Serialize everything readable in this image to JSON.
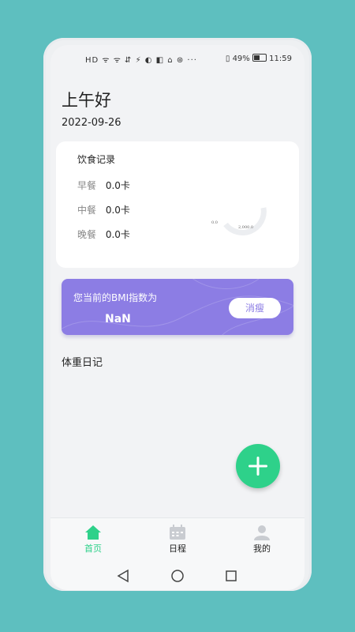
{
  "status_bar": {
    "left_icons": "HD ᯤ ᯤ ⇵ ⚡ ◐ ◧ ⌂ ⊛ ···",
    "battery": "49%",
    "time": "11:59"
  },
  "greeting": "上午好",
  "date": "2022-09-26",
  "diet_card": {
    "title": "饮食记录",
    "meals": [
      {
        "label": "早餐",
        "value": "0.0卡"
      },
      {
        "label": "中餐",
        "value": "0.0卡"
      },
      {
        "label": "晚餐",
        "value": "0.0卡"
      }
    ],
    "gauge": {
      "min_label": "0.0",
      "max_label": "2,000.0",
      "value": 0
    }
  },
  "bmi": {
    "label": "您当前的BMI指数为",
    "value": "NaN",
    "status_button": "消瘦"
  },
  "weight_diary": {
    "title": "体重日记"
  },
  "fab": {
    "icon": "plus-icon"
  },
  "tabs": [
    {
      "label": "首页",
      "icon": "home-icon",
      "active": true
    },
    {
      "label": "日程",
      "icon": "calendar-icon",
      "active": false
    },
    {
      "label": "我的",
      "icon": "user-icon",
      "active": false
    }
  ],
  "colors": {
    "background": "#5ebfbf",
    "accent_green": "#2ed18a",
    "bmi_purple": "#8c7de4",
    "inactive_icon": "#c9ccd1"
  }
}
